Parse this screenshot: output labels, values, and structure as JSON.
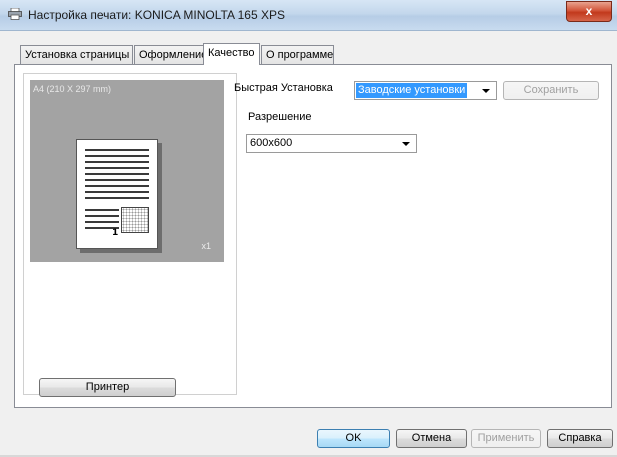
{
  "window": {
    "title": "Настройка печати: KONICA MINOLTA 165 XPS",
    "close_label": "x"
  },
  "tabs": [
    {
      "label": "Установка страницы"
    },
    {
      "label": "Оформление"
    },
    {
      "label": "Качество",
      "active": true
    },
    {
      "label": "О программе"
    }
  ],
  "preview": {
    "paper_size": "A4 (210 X 297 mm)",
    "copies": "x1",
    "stamp_number": "1"
  },
  "printer_button": "Принтер",
  "quick_setup": {
    "label": "Быстрая Установка",
    "value": "Заводские установки",
    "save_label": "Сохранить"
  },
  "resolution": {
    "label": "Разрешение",
    "value": "600x600"
  },
  "footer": {
    "ok": "OK",
    "cancel": "Отмена",
    "apply": "Применить",
    "help": "Справка"
  },
  "colors": {
    "selection": "#3399ff",
    "preview_bg": "#a3a3a3",
    "close_button": "#c2391c"
  }
}
